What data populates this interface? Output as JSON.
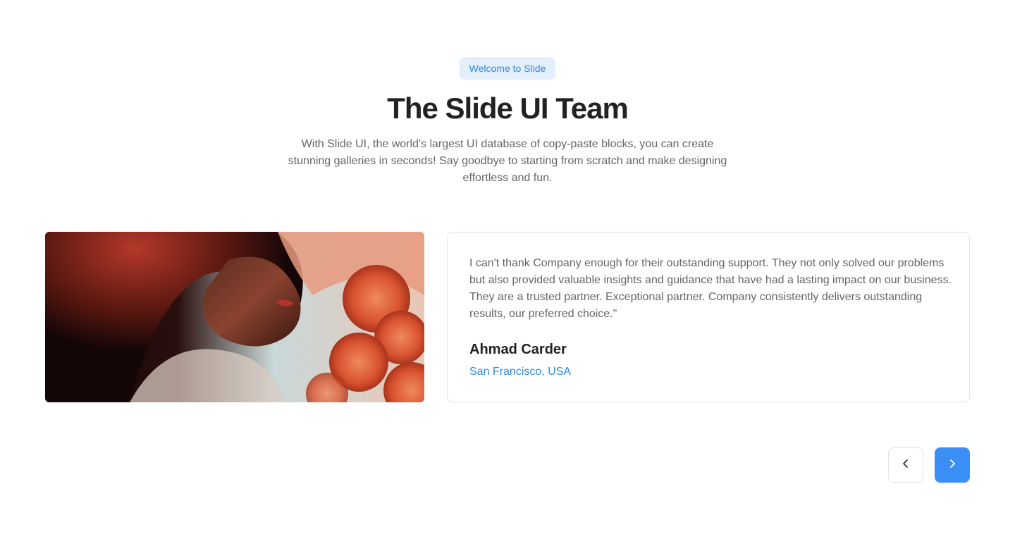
{
  "header": {
    "badge": "Welcome to Slide",
    "title": "The Slide UI Team",
    "subtitle": "With Slide UI, the world's largest UI database of copy-paste blocks, you can create stunning galleries in seconds! Say goodbye to starting from scratch and make designing effortless and fun."
  },
  "testimonial": {
    "quote": "I can't thank Company enough for their outstanding support. They not only solved our problems but also provided valuable insights and guidance that have had a lasting impact on our business. They are a trusted partner. Exceptional partner. Company consistently delivers outstanding results, our preferred choice.\"",
    "author": "Ahmad Carder",
    "location": "San Francisco, USA"
  },
  "navigation": {
    "prev_icon": "chevron-left-icon",
    "next_icon": "chevron-right-icon"
  },
  "colors": {
    "accent": "#3b8ef5",
    "badge_bg": "#e3effb",
    "link": "#2f8be0"
  }
}
